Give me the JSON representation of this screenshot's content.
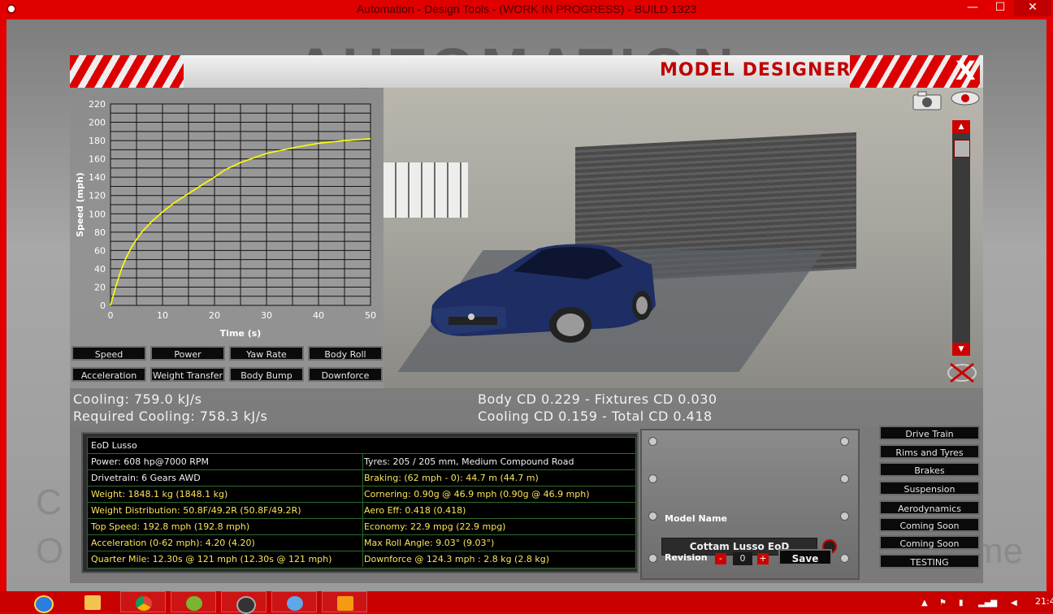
{
  "window": {
    "title": "Automation - Design Tools - (WORK IN PROGRESS) - BUILD 1323",
    "min": "—",
    "max": "☐",
    "close": "✕"
  },
  "background_text": {
    "logo": "AUTOMATION",
    "left_line1": "C",
    "left_line2": "O",
    "right_line": "me"
  },
  "designer": {
    "title": "MODEL DESIGNER",
    "close": "X"
  },
  "chart_data": {
    "type": "line",
    "xlabel": "Time (s)",
    "ylabel": "Speed (mph)",
    "xlim": [
      0,
      50
    ],
    "ylim": [
      0,
      220
    ],
    "x_ticks": [
      0,
      10,
      20,
      30,
      40,
      50
    ],
    "y_ticks": [
      0,
      20,
      40,
      60,
      80,
      100,
      120,
      140,
      160,
      180,
      200,
      220
    ],
    "grid": true,
    "series": [
      {
        "color": "#ffff00",
        "x": [
          0,
          1,
          2,
          3,
          4,
          5,
          6,
          8,
          10,
          12,
          15,
          18,
          20,
          22,
          25,
          28,
          30,
          35,
          40,
          45,
          50
        ],
        "y": [
          0,
          20,
          38,
          52,
          63,
          72,
          80,
          92,
          102,
          111,
          122,
          133,
          140,
          148,
          156,
          162,
          166,
          172,
          177,
          180,
          182
        ]
      }
    ]
  },
  "graph_buttons": [
    "Speed",
    "Power",
    "Yaw Rate",
    "Body Roll",
    "Acceleration",
    "Weight Transfer",
    "Body Bump",
    "Downforce"
  ],
  "stats": {
    "cooling": "Cooling: 759.0 kJ/s",
    "required_cooling": "Required Cooling: 758.3 kJ/s",
    "body_cd": "Body CD 0.229 - Fixtures CD 0.030",
    "cooling_cd": "Cooling CD 0.159 - Total CD 0.418"
  },
  "info": {
    "rows": [
      {
        "left": "EoD Lusso",
        "right": ""
      },
      {
        "left": "Power: 608 hp@7000 RPM",
        "right": "Tyres: 205 / 205 mm, Medium Compound Road"
      },
      {
        "left": "Drivetrain: 6 Gears AWD",
        "right": "Braking: (62 mph - 0): 44.7 m (44.7 m)"
      },
      {
        "left": "Weight: 1848.1 kg (1848.1 kg)",
        "right": "Cornering: 0.90g @ 46.9 mph (0.90g @ 46.9 mph)"
      },
      {
        "left": "Weight Distribution: 50.8F/49.2R (50.8F/49.2R)",
        "right": "Aero Eff: 0.418 (0.418)"
      },
      {
        "left": "Top Speed: 192.8 mph (192.8 mph)",
        "right": "Economy: 22.9 mpg (22.9 mpg)"
      },
      {
        "left": "Acceleration (0-62 mph): 4.20 (4.20)",
        "right": "Max Roll Angle: 9.03° (9.03°)"
      },
      {
        "left": "Quarter Mile: 12.30s @ 121 mph (12.30s @ 121 mph)",
        "right": "Downforce @ 124.3 mph : 2.8 kg (2.8 kg)"
      }
    ]
  },
  "model": {
    "name_label": "Model Name",
    "name_value": "Cottam Lusso EoD",
    "revision_label": "Revision",
    "revision_value": "0",
    "minus": "-",
    "plus": "+",
    "save": "Save"
  },
  "side_buttons": [
    "Drive Train",
    "Rims and Tyres",
    "Brakes",
    "Suspension",
    "Aerodynamics",
    "Coming Soon",
    "Coming Soon",
    "TESTING"
  ],
  "taskbar": {
    "clock": "21:4"
  },
  "colors": {
    "accent": "#e00000",
    "highlight_text": "#f5e65a",
    "car_body": "#1e2d63"
  }
}
